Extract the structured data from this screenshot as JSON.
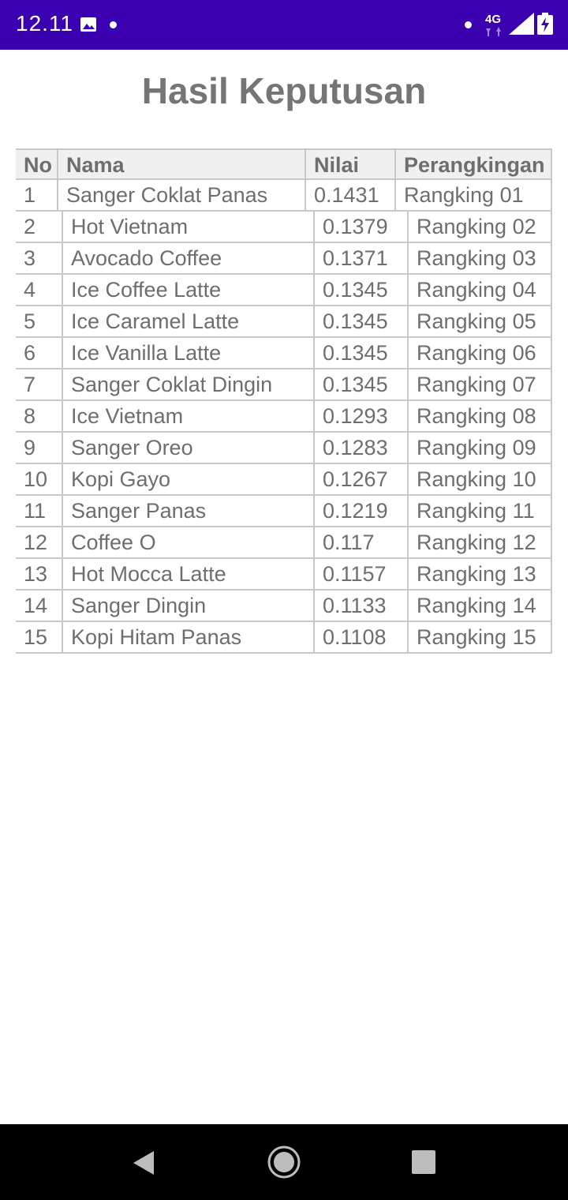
{
  "status_bar": {
    "time": "12.11",
    "network": "4G",
    "colors": {
      "background": "#3b00b0",
      "foreground": "#ffffff"
    },
    "icons": [
      "image-notification-icon",
      "notification-dot-icon",
      "mobile-data-4g-icon",
      "signal-icon",
      "battery-charging-icon"
    ]
  },
  "page": {
    "title": "Hasil Keputusan"
  },
  "table": {
    "headers": {
      "no": "No",
      "nama": "Nama",
      "nilai": "Nilai",
      "rank": "Perangkingan"
    },
    "rows": [
      {
        "no": "1",
        "nama": "Sanger Coklat Panas",
        "nilai": "0.1431",
        "rank": "Rangking 01"
      },
      {
        "no": "2",
        "nama": "Hot Vietnam",
        "nilai": "0.1379",
        "rank": "Rangking 02"
      },
      {
        "no": "3",
        "nama": "Avocado Coffee",
        "nilai": "0.1371",
        "rank": "Rangking 03"
      },
      {
        "no": "4",
        "nama": "Ice Coffee Latte",
        "nilai": "0.1345",
        "rank": "Rangking 04"
      },
      {
        "no": "5",
        "nama": "Ice Caramel Latte",
        "nilai": "0.1345",
        "rank": "Rangking 05"
      },
      {
        "no": "6",
        "nama": "Ice Vanilla Latte",
        "nilai": "0.1345",
        "rank": "Rangking 06"
      },
      {
        "no": "7",
        "nama": "Sanger Coklat Dingin",
        "nilai": "0.1345",
        "rank": "Rangking 07"
      },
      {
        "no": "8",
        "nama": "Ice Vietnam",
        "nilai": "0.1293",
        "rank": "Rangking 08"
      },
      {
        "no": "9",
        "nama": "Sanger Oreo",
        "nilai": "0.1283",
        "rank": "Rangking 09"
      },
      {
        "no": "10",
        "nama": "Kopi Gayo",
        "nilai": "0.1267",
        "rank": "Rangking 10"
      },
      {
        "no": "11",
        "nama": "Sanger Panas",
        "nilai": "0.1219",
        "rank": "Rangking 11"
      },
      {
        "no": "12",
        "nama": "Coffee O",
        "nilai": "0.117",
        "rank": "Rangking 12"
      },
      {
        "no": "13",
        "nama": "Hot Mocca Latte",
        "nilai": "0.1157",
        "rank": "Rangking 13"
      },
      {
        "no": "14",
        "nama": "Sanger Dingin",
        "nilai": "0.1133",
        "rank": "Rangking 14"
      },
      {
        "no": "15",
        "nama": "Kopi Hitam Panas",
        "nilai": "0.1108",
        "rank": "Rangking 15"
      }
    ]
  },
  "nav_bar": {
    "icons": [
      "back-icon",
      "home-icon",
      "recent-apps-icon"
    ],
    "colors": {
      "background": "#000000",
      "icon": "#bdbdbd"
    }
  }
}
